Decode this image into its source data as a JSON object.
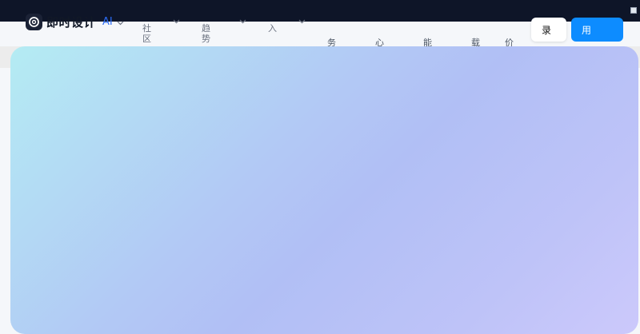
{
  "header": {
    "logo_text": "即时设计",
    "ai_label": "AI",
    "nav": [
      {
        "label": "社区"
      },
      {
        "label": "趋势"
      },
      {
        "label": "入"
      }
    ],
    "nav_chars": [
      "务",
      "心",
      "能",
      "载",
      "价"
    ],
    "login_label": "录",
    "use_label": "用"
  },
  "colors": {
    "topbar": "#0e1528",
    "accent": "#0d8cff",
    "ai": "#2b6cf6"
  }
}
